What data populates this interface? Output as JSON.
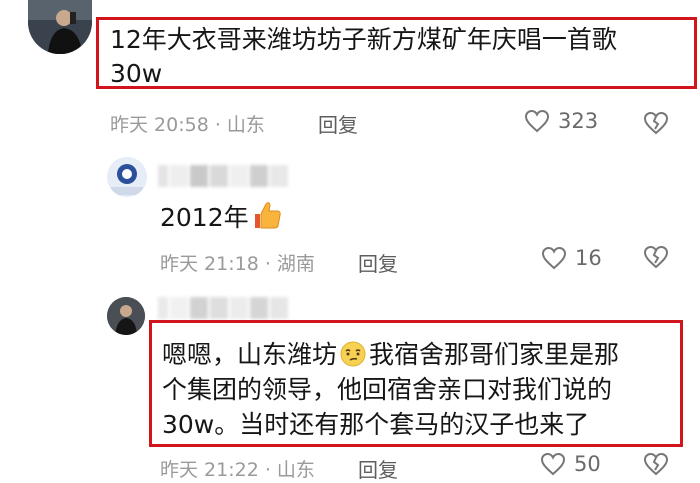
{
  "comments": [
    {
      "text_lines": [
        "12年大衣哥来潍坊坊子新方煤矿年庆唱一首歌",
        "30w"
      ],
      "meta": "昨天 20:58 · 山东",
      "reply_label": "回复",
      "likes": "323"
    },
    {
      "text": "2012年",
      "emoji": "thumbs-up",
      "meta": "昨天 21:18 · 湖南",
      "reply_label": "回复",
      "likes": "16"
    },
    {
      "text_lines": [
        "嗯嗯，山东潍坊",
        "我宿舍那哥们家里是那",
        "个集团的领导，他回宿舍亲口对我们说的",
        "30w。当时还有那个套马的汉子也来了"
      ],
      "meta": "昨天 21:22 · 山东",
      "reply_label": "回复",
      "likes": "50"
    }
  ],
  "colors": {
    "highlight": "#d2151d",
    "meta": "#9a9a9a",
    "text": "#161616"
  },
  "icons": [
    "heart-outline-icon",
    "broken-heart-icon",
    "thumbs-up-emoji",
    "smirk-emoji"
  ]
}
